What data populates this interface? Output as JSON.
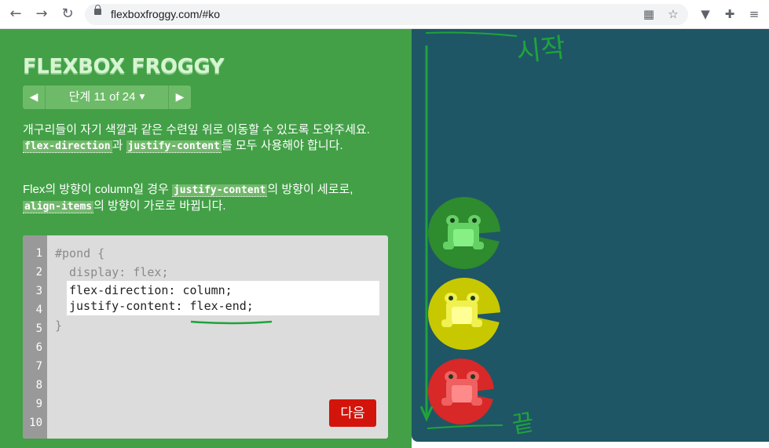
{
  "browser": {
    "url": "flexboxfroggy.com/#ko",
    "back_glyph": "←",
    "forward_glyph": "→",
    "reload_glyph": "↻",
    "qr_glyph": "▦",
    "star_glyph": "☆",
    "ext1_glyph": "▼",
    "ext2_glyph": "✚",
    "menu_glyph": "≡"
  },
  "game": {
    "logo": "FLEXBOX FROGGY",
    "level": {
      "prev_glyph": "◀",
      "next_glyph": "▶",
      "label": "단계 11 of 24",
      "caret": "▼"
    },
    "instructions": {
      "p1_text_a": "개구리들이 자기 색깔과 같은 수련잎 위로 이동할 수 있도록 도와주세요. ",
      "p1_code_a": "flex-direction",
      "p1_text_b": "과 ",
      "p1_code_b": "justify-content",
      "p1_text_c": "를 모두 사용해야 합니다.",
      "p2_text_a": "Flex의 방향이 column일 경우 ",
      "p2_code_a": "justify-content",
      "p2_text_b": "의 방향이 세로로, ",
      "p2_code_b": "align-items",
      "p2_text_c": "의 방향이 가로로 바뀝니다."
    },
    "editor": {
      "line_numbers": [
        "1",
        "2",
        "3",
        "4",
        "5",
        "6",
        "7",
        "8",
        "9",
        "10"
      ],
      "line1": "#pond {",
      "line2": "  display: flex;",
      "input1": "flex-direction: column;",
      "input2": "justify-content: flex-end;",
      "closing": "}",
      "next_button": "다음"
    }
  },
  "pond": {
    "lilypads": [
      {
        "color": "green",
        "pad": "#2e8b2e",
        "frog_body": "#64d164",
        "frog_belly": "#86f086"
      },
      {
        "color": "yellow",
        "pad": "#c8c800",
        "frog_body": "#f0f050",
        "frog_belly": "#ffff96"
      },
      {
        "color": "red",
        "pad": "#d82828",
        "frog_body": "#f06060",
        "frog_belly": "#ff8a8a"
      }
    ]
  },
  "annotations": {
    "top_note": "시작",
    "bottom_note": "끝"
  },
  "colors": {
    "left_bg": "#43a047",
    "pond_bg": "#1e5666",
    "annotation": "#1fa33a",
    "next_button": "#d3140b"
  }
}
